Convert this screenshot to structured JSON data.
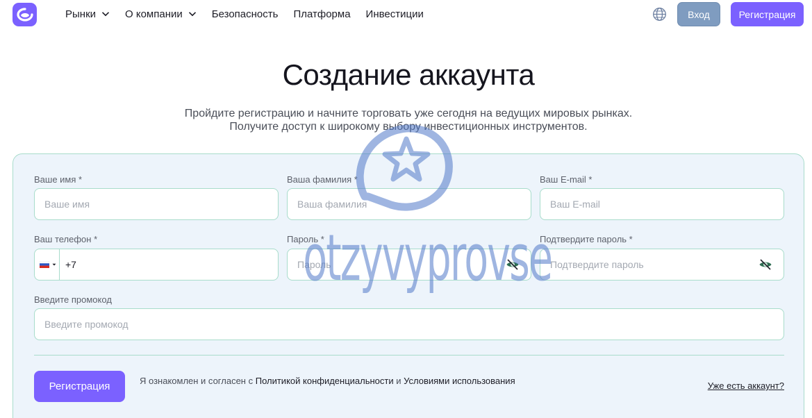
{
  "header": {
    "logo_icon": "brand-logo-icon",
    "nav": [
      {
        "label": "Рынки",
        "dropdown": true
      },
      {
        "label": "О компании",
        "dropdown": true
      },
      {
        "label": "Безопасность",
        "dropdown": false
      },
      {
        "label": "Платформа",
        "dropdown": false
      },
      {
        "label": "Инвестиции",
        "dropdown": false
      }
    ],
    "language_icon": "globe-icon",
    "login_label": "Вход",
    "register_label": "Регистрация"
  },
  "hero": {
    "title": "Создание аккаунта",
    "subtitle_line1": "Пройдите регистрацию и начните торговать уже сегодня на ведущих мировых рынках.",
    "subtitle_line2": "Получите доступ к широкому выбору инвестиционных инструментов."
  },
  "form": {
    "first_name": {
      "label": "Ваше имя *",
      "placeholder": "Ваше имя",
      "value": ""
    },
    "last_name": {
      "label": "Ваша фамилия *",
      "placeholder": "Ваша фамилия",
      "value": ""
    },
    "email": {
      "label": "Ваш E-mail *",
      "placeholder": "Ваш E-mail",
      "value": ""
    },
    "phone": {
      "label": "Ваш телефон *",
      "country_icon": "russia-flag-icon",
      "value": "+7"
    },
    "password": {
      "label": "Пароль *",
      "placeholder": "Пароль",
      "value": ""
    },
    "confirm_password": {
      "label": "Подтвердите пароль *",
      "placeholder": "Подтвердите пароль",
      "value": ""
    },
    "promo": {
      "label": "Введите промокод",
      "placeholder": "Введите промокод",
      "value": ""
    },
    "submit_label": "Регистрация",
    "agree_text_1": "Я ознакомлен и согласен с ",
    "agree_policy": "Политикой конфиденциальности",
    "agree_text_2": " и ",
    "agree_terms": "Условиями использования",
    "have_account": "Уже есть аккаунт?"
  },
  "watermark": {
    "text": "otzyvyprovse"
  },
  "colors": {
    "accent": "#7b61ff",
    "login_button": "#7f9cc0",
    "border": "#a8dccb",
    "card_bg": "#edf4fb"
  }
}
